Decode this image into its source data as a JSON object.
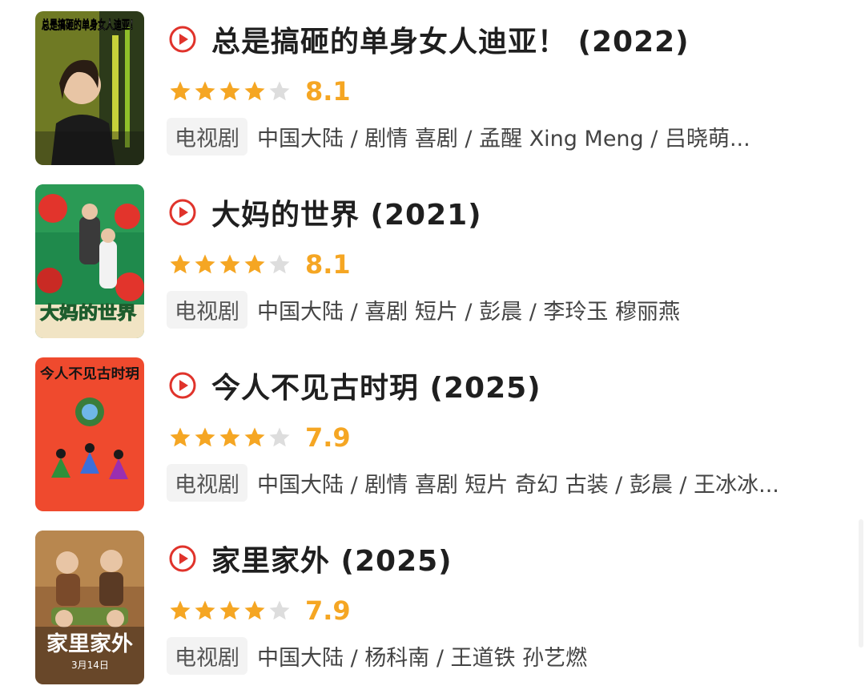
{
  "items": [
    {
      "title": "总是搞砸的单身女人迪亚！ (2022)",
      "rating": "8.1",
      "stars": 4,
      "tag": "电视剧",
      "meta": "中国大陆 / 剧情 喜剧 / 孟醒 Xing Meng / 吕晓萌...",
      "poster_text": "总是搞砸的单身女人迪亚！",
      "poster_colors": {
        "bg": "#7d8a2e",
        "accent": "#e8d24a"
      }
    },
    {
      "title": "大妈的世界 (2021)",
      "rating": "8.1",
      "stars": 4,
      "tag": "电视剧",
      "meta": "中国大陆 / 喜剧 短片 / 彭晨 / 李玲玉 穆丽燕",
      "poster_text": "大妈的世界",
      "poster_colors": {
        "bg": "#1f8a4c",
        "accent": "#e2342c"
      }
    },
    {
      "title": "今人不见古时玥 (2025)",
      "rating": "7.9",
      "stars": 4,
      "tag": "电视剧",
      "meta": "中国大陆 / 剧情 喜剧 短片 奇幻 古装 / 彭晨 / 王冰冰...",
      "poster_text": "今人不见古时玥",
      "poster_colors": {
        "bg": "#ef4a2e",
        "accent": "#3a7d3a"
      }
    },
    {
      "title": "家里家外 (2025)",
      "rating": "7.9",
      "stars": 4,
      "tag": "电视剧",
      "meta": "中国大陆 / 杨科南 / 王道铁 孙艺燃",
      "poster_text": "家里家外",
      "poster_date": "3月14日",
      "poster_colors": {
        "bg": "#9b6a3c",
        "accent": "#d9b97c"
      }
    }
  ],
  "colors": {
    "play_icon": "#e0332b",
    "star_filled": "#f5a623",
    "star_empty": "#dddddd",
    "rating_text": "#f5a623"
  },
  "icons": {
    "play": "play-circle-icon",
    "star": "star-icon"
  }
}
